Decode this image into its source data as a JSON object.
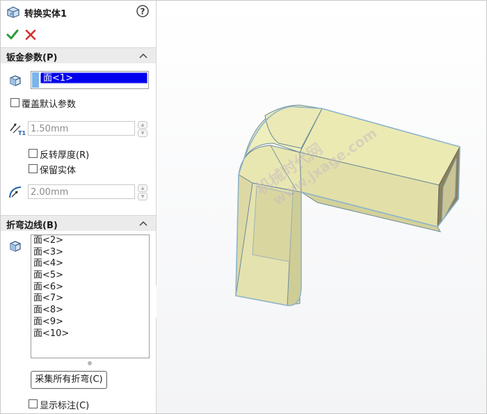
{
  "panel": {
    "title": "转换实体1",
    "help_icon": "help-icon",
    "ok_icon": "check-icon",
    "cancel_icon": "close-icon",
    "sheet_params": {
      "header": "钣金参数(P)",
      "fixed_face_value": "面<1>",
      "override_label": "覆盖默认参数",
      "thickness_value": "1.50mm",
      "reverse_thickness_label": "反转厚度(R)",
      "keep_body_label": "保留实体",
      "radius_value": "2.00mm"
    },
    "bend_edges": {
      "header": "折弯边线(B)",
      "items": [
        "面<2>",
        "面<3>",
        "面<4>",
        "面<5>",
        "面<6>",
        "面<7>",
        "面<8>",
        "面<9>",
        "面<10>"
      ],
      "collect_button": "采集所有折弯(C)",
      "show_callouts_label": "显示标注(C)"
    }
  },
  "viewport": {
    "watermark_line1": "机械时代网",
    "watermark_line2": "www.jxage.com"
  }
}
